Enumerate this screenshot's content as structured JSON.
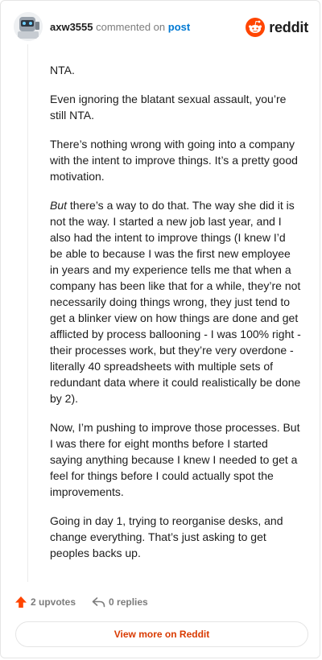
{
  "comment": {
    "username": "axw3555",
    "action": "commented on",
    "target": "post",
    "paragraphs": [
      {
        "emphasis": "",
        "text": "NTA."
      },
      {
        "emphasis": "",
        "text": "Even ignoring the blatant sexual assault, you’re still NTA."
      },
      {
        "emphasis": "",
        "text": "There’s nothing wrong with going into a company with the intent to improve things. It’s a pretty good motivation."
      },
      {
        "emphasis": "But",
        "text": " there’s a way to do that. The way she did it is not the way. I started a new job last year, and I also had the intent to improve things (I knew I’d be able to because I was the first new employee in years and my experience tells me that when a company has been like that for a while, they’re not necessarily doing things wrong, they just tend to get a blinker view on how things are done and get afflicted by process ballooning - I was 100% right - their processes work, but they’re very overdone - literally 40 spreadsheets with multiple sets of redundant data where it could realistically be done by 2)."
      },
      {
        "emphasis": "",
        "text": "Now, I’m pushing to improve those processes. But I was there for eight months before I started saying anything because I knew I needed to get a feel for things before I could actually spot the improvements."
      },
      {
        "emphasis": "",
        "text": "Going in day 1, trying to reorganise desks, and change everything. That’s just asking to get peoples backs up."
      }
    ],
    "upvotes": "2 upvotes",
    "replies": "0 replies"
  },
  "brand": {
    "name": "reddit",
    "color": "#ff4500",
    "icon": "reddit-snoo-icon"
  },
  "view_more_label": "View more on Reddit",
  "colors": {
    "link": "#0079d3",
    "upvote": "#ff4500",
    "view_more": "#d93a00",
    "muted": "#7c7c7c"
  },
  "icons": {
    "avatar": "avatar-icon",
    "upvote": "upvote-arrow-icon",
    "reply": "reply-arrow-icon"
  }
}
